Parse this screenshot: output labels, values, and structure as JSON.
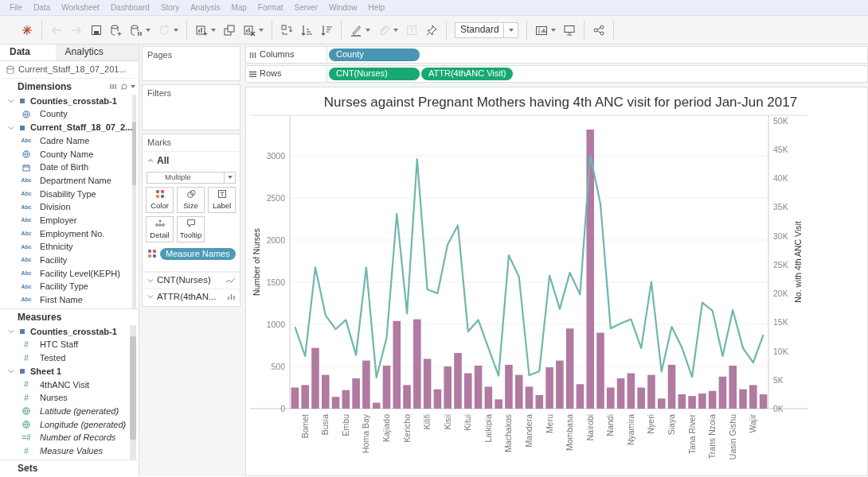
{
  "menu": [
    "File",
    "Data",
    "Worksheet",
    "Dashboard",
    "Story",
    "Analysis",
    "Map",
    "Format",
    "Server",
    "Window",
    "Help"
  ],
  "toolbar": {
    "groups": [
      [
        {
          "kind": "logo",
          "disabled": false,
          "menu": false
        }
      ],
      [
        {
          "kind": "back",
          "disabled": true,
          "menu": false
        },
        {
          "kind": "forward",
          "disabled": true,
          "menu": false
        },
        {
          "kind": "save",
          "disabled": false,
          "menu": false
        },
        {
          "kind": "add-data",
          "disabled": false,
          "menu": false
        },
        {
          "kind": "pause",
          "disabled": false,
          "menu": true
        },
        {
          "kind": "refresh",
          "disabled": true,
          "menu": true
        }
      ],
      [
        {
          "kind": "new-sheet",
          "disabled": false,
          "menu": true
        },
        {
          "kind": "duplicate",
          "disabled": false,
          "menu": false
        },
        {
          "kind": "clear",
          "disabled": false,
          "menu": true
        }
      ],
      [
        {
          "kind": "swap",
          "disabled": false,
          "menu": false
        },
        {
          "kind": "sort-asc",
          "disabled": false,
          "menu": false
        },
        {
          "kind": "sort-desc",
          "disabled": false,
          "menu": false
        }
      ],
      [
        {
          "kind": "highlight",
          "disabled": false,
          "menu": true
        },
        {
          "kind": "attach",
          "disabled": true,
          "menu": true
        },
        {
          "kind": "text",
          "disabled": true,
          "menu": false
        },
        {
          "kind": "pin",
          "disabled": false,
          "menu": false
        }
      ]
    ],
    "fit": "Standard",
    "end_groups": [
      [
        {
          "kind": "show-me",
          "disabled": false,
          "menu": true
        },
        {
          "kind": "present",
          "disabled": false,
          "menu": false
        }
      ],
      [
        {
          "kind": "share",
          "disabled": false,
          "menu": false
        }
      ]
    ]
  },
  "left_panel": {
    "tabs": [
      {
        "label": "Data",
        "selected": true
      },
      {
        "label": "Analytics",
        "selected": false
      }
    ],
    "data_source": "Current_Staff_18_07_201...",
    "dimensions": {
      "title": "Dimensions",
      "entries": [
        {
          "kind": "group",
          "label": "Counties_crosstab-1",
          "expanded": true,
          "children": [
            {
              "kind": "globe",
              "label": "County",
              "italic": false
            }
          ]
        },
        {
          "kind": "group",
          "label": "Current_Staff_18_07_2...",
          "expanded": true,
          "children": [
            {
              "kind": "glyph",
              "glyph": "Abc",
              "label": "Cadre Name",
              "italic": false
            },
            {
              "kind": "globe",
              "label": "County Name",
              "italic": false
            },
            {
              "kind": "date",
              "label": "Date of Birth",
              "italic": false
            },
            {
              "kind": "glyph",
              "glyph": "Abc",
              "label": "Department Name",
              "italic": false
            },
            {
              "kind": "glyph",
              "glyph": "Abc",
              "label": "Disability Type",
              "italic": false
            },
            {
              "kind": "glyph",
              "glyph": "Abc",
              "label": "Division",
              "italic": false
            },
            {
              "kind": "glyph",
              "glyph": "Abc",
              "label": "Employer",
              "italic": false
            },
            {
              "kind": "glyph",
              "glyph": "Abc",
              "label": "Employment No.",
              "italic": false
            },
            {
              "kind": "glyph",
              "glyph": "Abc",
              "label": "Ethnicity",
              "italic": false
            },
            {
              "kind": "glyph",
              "glyph": "Abc",
              "label": "Facility",
              "italic": false
            },
            {
              "kind": "glyph",
              "glyph": "Abc",
              "label": "Facility Level(KEPH)",
              "italic": false
            },
            {
              "kind": "glyph",
              "glyph": "Abc",
              "label": "Facility Type",
              "italic": false
            },
            {
              "kind": "glyph",
              "glyph": "Abc",
              "label": "First Name",
              "italic": false
            }
          ]
        }
      ]
    },
    "measures": {
      "title": "Measures",
      "entries": [
        {
          "kind": "group",
          "label": "Counties_crosstab-1",
          "expanded": true,
          "children": [
            {
              "kind": "glyph",
              "glyph": "#",
              "label": "HTC Staff",
              "italic": false
            },
            {
              "kind": "glyph",
              "glyph": "#",
              "label": "Tested",
              "italic": false
            }
          ]
        },
        {
          "kind": "group",
          "label": "Sheet 1",
          "expanded": true,
          "children": [
            {
              "kind": "glyph",
              "glyph": "#",
              "label": "4thANC Visit",
              "italic": false
            },
            {
              "kind": "glyph",
              "glyph": "#",
              "label": "Nurses",
              "italic": false
            }
          ]
        },
        {
          "kind": "globe",
          "label": "Latitude (generated)",
          "italic": true
        },
        {
          "kind": "globe",
          "label": "Longitude (generated)",
          "italic": true
        },
        {
          "kind": "glyph",
          "glyph": "=#",
          "label": "Number of Records",
          "italic": true
        },
        {
          "kind": "glyph",
          "glyph": "#",
          "label": "Measure Values",
          "italic": true
        }
      ]
    },
    "sets": {
      "title": "Sets"
    }
  },
  "pages": {
    "title": "Pages"
  },
  "filters": {
    "title": "Filters"
  },
  "marks": {
    "title": "Marks",
    "section": "All",
    "expanded": true,
    "mark_type": "Multiple",
    "buttons": [
      {
        "label": "Color",
        "kind": "color"
      },
      {
        "label": "Size",
        "kind": "size"
      },
      {
        "label": "Label",
        "kind": "label"
      },
      {
        "label": "Detail",
        "kind": "detail"
      },
      {
        "label": "Tooltip",
        "kind": "tooltip"
      }
    ],
    "pills": [
      {
        "label": "Measure Names",
        "kind": "color"
      }
    ],
    "layers": [
      {
        "label": "CNT(Nurses)",
        "kind": "line",
        "expanded": false
      },
      {
        "label": "ATTR(4thAN...",
        "kind": "bar",
        "expanded": false
      }
    ]
  },
  "columns_shelf": {
    "label": "Columns",
    "pills": [
      {
        "label": "County",
        "kind": "discrete"
      }
    ]
  },
  "rows_shelf": {
    "label": "Rows",
    "pills": [
      {
        "label": "CNT(Nurses)",
        "kind": "continuous"
      },
      {
        "label": "ATTR(4thANC Visit)",
        "kind": "continuous"
      }
    ]
  },
  "chart": {
    "title": "Nurses against Pregnant Mothers having 4th ANC visit for period Jan-Jun 2017",
    "layers": [
      {
        "chart_data": {
          "type": "bar",
          "ylabel": "Number of Nurses",
          "grid": true,
          "categories": [
            null,
            "Bomet",
            null,
            "Busia",
            null,
            "Embu",
            null,
            "Homa Bay",
            null,
            "Kajiado",
            null,
            "Kericho",
            null,
            "Kilifi",
            null,
            "Kisii",
            null,
            "Kitui",
            null,
            "Laikipia",
            null,
            "Machakos",
            null,
            "Mandera",
            null,
            "Meru",
            null,
            "Mombasa",
            null,
            "Nairobi",
            null,
            "Nandi",
            null,
            "Nyamira",
            null,
            "Nyeri",
            null,
            "Siaya",
            null,
            "Tana River",
            null,
            "Trans Nzoia",
            null,
            "Uasin Gishu",
            null,
            "Wajir",
            null
          ],
          "ylim": [
            0,
            3480
          ],
          "yticks": [
            0,
            500,
            1000,
            1500,
            2000,
            2500,
            3000
          ],
          "series": [
            {
              "color": "#b07aa1",
              "values": [
                250,
                280,
                720,
                400,
                140,
                220,
                360,
                570,
                70,
                510,
                1040,
                280,
                1060,
                590,
                230,
                500,
                660,
                420,
                510,
                260,
                110,
                520,
                400,
                260,
                160,
                490,
                570,
                950,
                290,
                3310,
                900,
                250,
                360,
                420,
                250,
                400,
                120,
                520,
                170,
                150,
                180,
                210,
                380,
                510,
                230,
                280,
                170
              ]
            }
          ]
        }
      },
      {
        "chart_data": {
          "type": "line",
          "ylabel": "No. with 4th ANC Visit",
          "ylim": [
            0,
            50900
          ],
          "yticks": [
            {
              "value": 0,
              "label": "0K"
            },
            {
              "value": 5000,
              "label": "5K"
            },
            {
              "value": 10000,
              "label": "10K"
            },
            {
              "value": 15000,
              "label": "15K"
            },
            {
              "value": 20000,
              "label": "20K"
            },
            {
              "value": 25000,
              "label": "25K"
            },
            {
              "value": 30000,
              "label": "30K"
            },
            {
              "value": 35000,
              "label": "35K"
            },
            {
              "value": 40000,
              "label": "40K"
            },
            {
              "value": 45000,
              "label": "45K"
            },
            {
              "value": 50000,
              "label": "50K"
            }
          ],
          "series": [
            {
              "color": "#6fb7ad",
              "values": [
                14200,
                9100,
                24500,
                16200,
                13800,
                15400,
                9300,
                24500,
                5400,
                12300,
                33800,
                16500,
                43300,
                20700,
                20000,
                28500,
                31800,
                13400,
                15400,
                10500,
                5700,
                26600,
                22900,
                5800,
                6500,
                23100,
                17300,
                23600,
                19800,
                44000,
                35500,
                13900,
                14800,
                15500,
                10500,
                22000,
                6400,
                14200,
                10600,
                5500,
                18400,
                17000,
                9100,
                17100,
                10500,
                8000,
                12800
              ]
            }
          ]
        }
      }
    ]
  }
}
